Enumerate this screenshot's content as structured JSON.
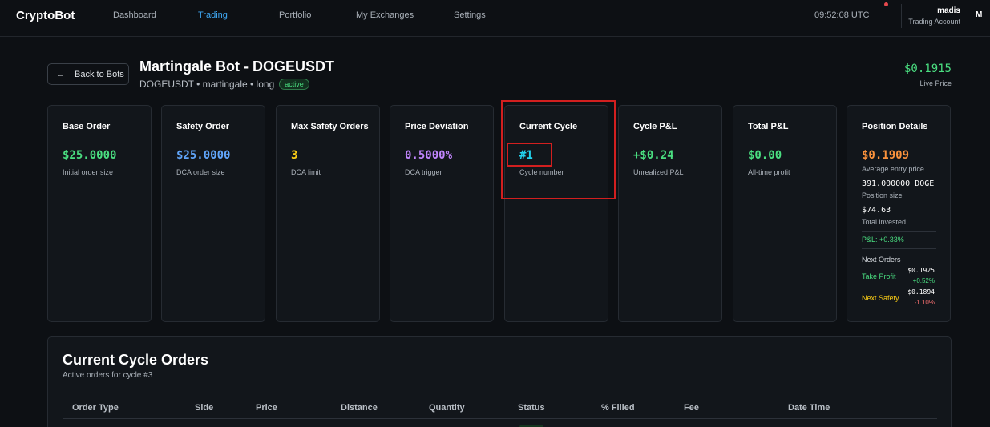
{
  "app": {
    "brand": "CryptoBot"
  },
  "nav": [
    "Dashboard",
    "Trading",
    "Portfolio",
    "My Exchanges",
    "Settings"
  ],
  "nav_active": "Trading",
  "clock": "09:52:08 UTC",
  "user": {
    "name": "madis",
    "account": "Trading Account",
    "avatar_letter": "M"
  },
  "header": {
    "back_label": "Back to Bots",
    "title": "Martingale Bot - DOGEUSDT",
    "subtitle": "DOGEUSDT • martingale • long",
    "status": "active",
    "live_price": "$0.1915",
    "live_label": "Live Price"
  },
  "cards": [
    {
      "title": "Base Order",
      "value": "$25.0000",
      "desc": "Initial order size",
      "color": "#4ade80"
    },
    {
      "title": "Safety Order",
      "value": "$25.0000",
      "desc": "DCA order size",
      "color": "#60a5fa"
    },
    {
      "title": "Max Safety Orders",
      "value": "3",
      "desc": "DCA limit",
      "color": "#facc15"
    },
    {
      "title": "Price Deviation",
      "value": "0.5000%",
      "desc": "DCA trigger",
      "color": "#c084fc"
    },
    {
      "title": "Current Cycle",
      "value": "#1",
      "desc": "Cycle number",
      "color": "#22d3ee"
    },
    {
      "title": "Cycle P&L",
      "value": "+$0.24",
      "desc": "Unrealized P&L",
      "color": "#4ade80"
    },
    {
      "title": "Total P&L",
      "value": "$0.00",
      "desc": "All-time profit",
      "color": "#4ade80"
    }
  ],
  "position": {
    "title": "Position Details",
    "avg_price": "$0.1909",
    "avg_label": "Average entry price",
    "size": "391.000000 DOGE",
    "size_label": "Position size",
    "invested": "$74.63",
    "invested_label": "Total invested",
    "pnl": "P&L: +0.33%",
    "next_orders_label": "Next Orders",
    "take_profit_label": "Take Profit",
    "take_profit_price": "$0.1925",
    "take_profit_pct": "+0.52%",
    "next_safety_label": "Next Safety",
    "next_safety_price": "$0.1894",
    "next_safety_pct": "-1.10%"
  },
  "orders": {
    "title": "Current Cycle Orders",
    "subtitle": "Active orders for cycle #3",
    "columns": [
      "Order Type",
      "Side",
      "Price",
      "Distance",
      "Quantity",
      "Status",
      "% Filled",
      "Fee",
      "Date Time"
    ]
  },
  "colors": {
    "green": "#4ade80",
    "red": "#f87171",
    "orange": "#fb923c",
    "yellow": "#facc15",
    "highlight": "#d21f1f"
  }
}
